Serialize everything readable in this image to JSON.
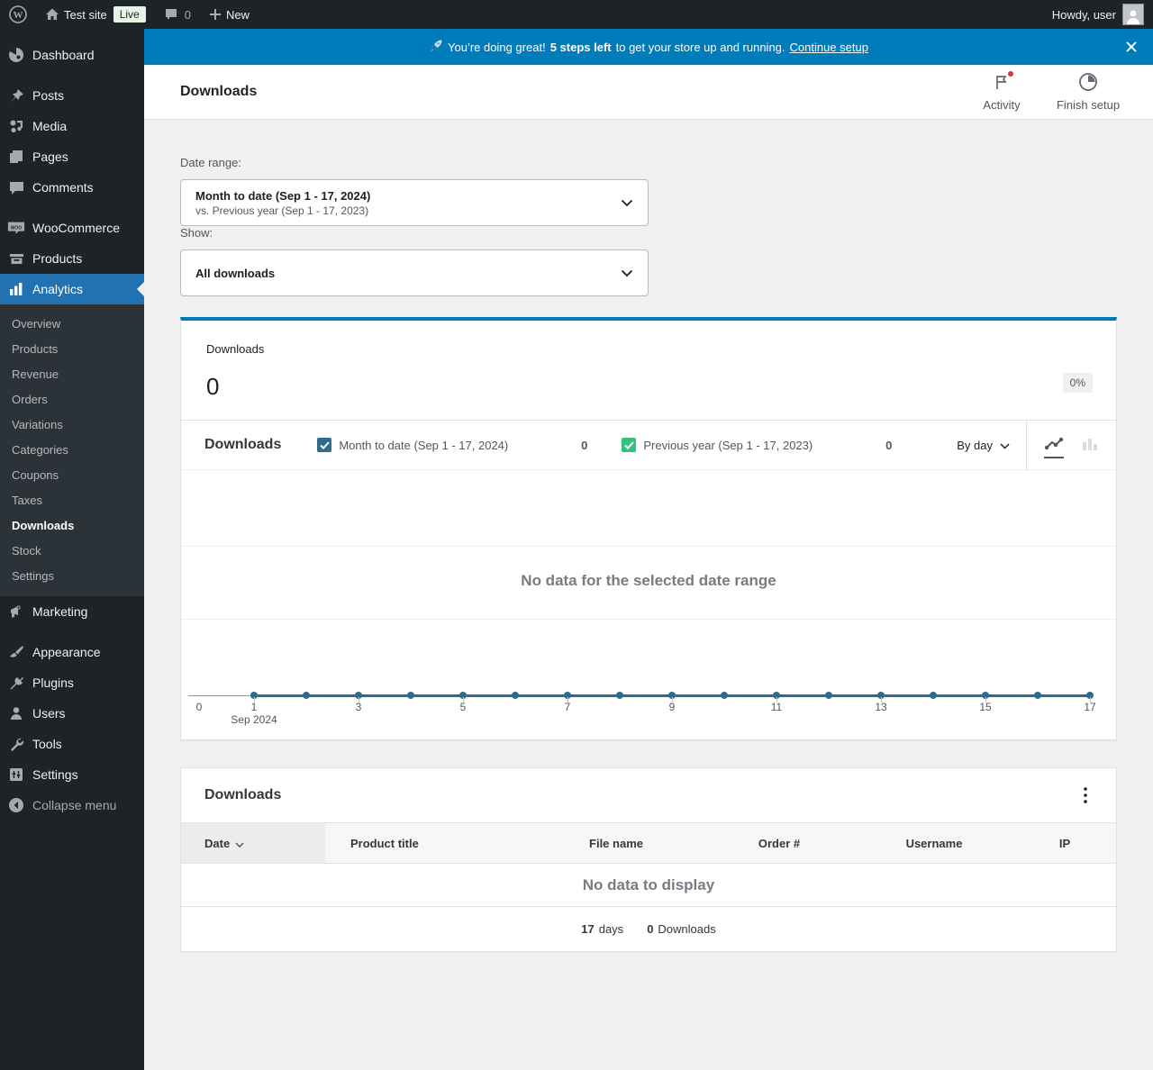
{
  "colors": {
    "accent_blue": "#2271b1",
    "notice_blue": "#007cba",
    "chart_current": "#2c6d8e",
    "chart_previous": "#2ec47d"
  },
  "admin_bar": {
    "site_name": "Test site",
    "live_badge": "Live",
    "comment_count": "0",
    "new_label": "New",
    "howdy": "Howdy, user"
  },
  "notice": {
    "icon": "rocket",
    "text_prefix": "You’re doing great!",
    "bold": "5 steps left",
    "text_suffix": "to get your store up and running.",
    "link": "Continue setup"
  },
  "header": {
    "title": "Downloads",
    "activity_label": "Activity",
    "finish_setup_label": "Finish setup"
  },
  "filters": {
    "date_range_label": "Date range:",
    "date_range_primary": "Month to date (Sep 1 - 17, 2024)",
    "date_range_secondary": "vs. Previous year (Sep 1 - 17, 2023)",
    "show_label": "Show:",
    "show_value": "All downloads"
  },
  "summary": {
    "label": "Downloads",
    "value": "0",
    "delta": "0%"
  },
  "chart": {
    "title": "Downloads",
    "legend": [
      {
        "label": "Month to date (Sep 1 - 17, 2024)",
        "value": "0",
        "color": "#2c6d8e"
      },
      {
        "label": "Previous year (Sep 1 - 17, 2023)",
        "value": "0",
        "color": "#2ec47d"
      }
    ],
    "interval_label": "By day",
    "empty_message": "No data for the selected date range",
    "x_axis": {
      "labels": [
        "0",
        "1",
        "3",
        "5",
        "7",
        "9",
        "11",
        "13",
        "15",
        "17"
      ],
      "sub_label": "Sep 2024"
    }
  },
  "chart_data": {
    "type": "line",
    "title": "Downloads",
    "x": [
      1,
      2,
      3,
      4,
      5,
      6,
      7,
      8,
      9,
      10,
      11,
      12,
      13,
      14,
      15,
      16,
      17
    ],
    "x_tick_labels": [
      "0",
      "1",
      "3",
      "5",
      "7",
      "9",
      "11",
      "13",
      "15",
      "17"
    ],
    "x_sub_label": "Sep 2024",
    "y_axis_zero_label": "0",
    "ylim": [
      0,
      1
    ],
    "grid": true,
    "series": [
      {
        "name": "Month to date (Sep 1 - 17, 2024)",
        "color": "#2c6d8e",
        "values": [
          0,
          0,
          0,
          0,
          0,
          0,
          0,
          0,
          0,
          0,
          0,
          0,
          0,
          0,
          0,
          0,
          0
        ]
      },
      {
        "name": "Previous year (Sep 1 - 17, 2023)",
        "color": "#2ec47d",
        "values": [
          0,
          0,
          0,
          0,
          0,
          0,
          0,
          0,
          0,
          0,
          0,
          0,
          0,
          0,
          0,
          0,
          0
        ]
      }
    ],
    "empty_message": "No data for the selected date range"
  },
  "table": {
    "title": "Downloads",
    "columns": [
      "Date",
      "Product title",
      "File name",
      "Order #",
      "Username",
      "IP"
    ],
    "empty_message": "No data to display",
    "footer": {
      "days_value": "17",
      "days_label": "days",
      "downloads_value": "0",
      "downloads_label": "Downloads"
    }
  },
  "sidebar": {
    "items": [
      {
        "label": "Dashboard"
      },
      {
        "label": "Posts"
      },
      {
        "label": "Media"
      },
      {
        "label": "Pages"
      },
      {
        "label": "Comments"
      },
      {
        "label": "WooCommerce"
      },
      {
        "label": "Products"
      },
      {
        "label": "Analytics",
        "active": true
      },
      {
        "label": "Marketing"
      },
      {
        "label": "Appearance"
      },
      {
        "label": "Plugins"
      },
      {
        "label": "Users"
      },
      {
        "label": "Tools"
      },
      {
        "label": "Settings"
      },
      {
        "label": "Collapse menu"
      }
    ],
    "analytics_submenu": [
      {
        "label": "Overview"
      },
      {
        "label": "Products"
      },
      {
        "label": "Revenue"
      },
      {
        "label": "Orders"
      },
      {
        "label": "Variations"
      },
      {
        "label": "Categories"
      },
      {
        "label": "Coupons"
      },
      {
        "label": "Taxes"
      },
      {
        "label": "Downloads",
        "current": true
      },
      {
        "label": "Stock"
      },
      {
        "label": "Settings"
      }
    ]
  }
}
